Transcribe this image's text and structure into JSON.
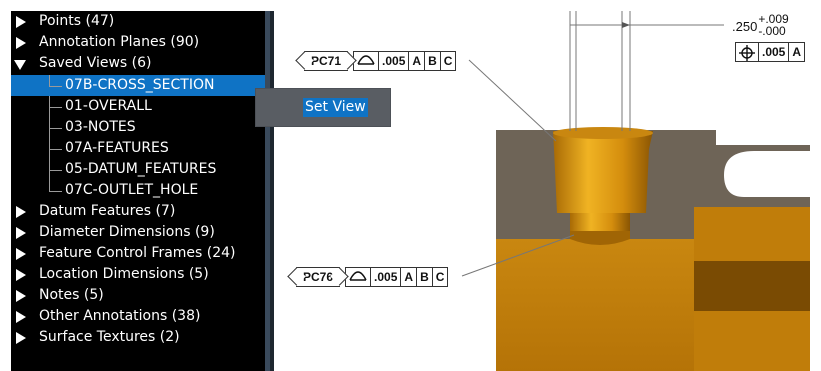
{
  "tree": {
    "top_items": [
      {
        "label": "Points (47)",
        "expanded": false
      },
      {
        "label": "Annotation Planes (90)",
        "expanded": false
      },
      {
        "label": "Saved Views (6)",
        "expanded": true
      },
      {
        "label": "Datum Features (7)",
        "expanded": false
      },
      {
        "label": "Diameter Dimensions (9)",
        "expanded": false
      },
      {
        "label": "Feature Control Frames (24)",
        "expanded": false
      },
      {
        "label": "Location Dimensions (5)",
        "expanded": false
      },
      {
        "label": "Notes (5)",
        "expanded": false
      },
      {
        "label": "Other Annotations (38)",
        "expanded": false
      },
      {
        "label": "Surface Textures (2)",
        "expanded": false
      }
    ],
    "saved_views": [
      {
        "label": "07B-CROSS_SECTION",
        "selected": true
      },
      {
        "label": "01-OVERALL",
        "selected": false
      },
      {
        "label": "03-NOTES",
        "selected": false
      },
      {
        "label": "07A-FEATURES",
        "selected": false
      },
      {
        "label": "05-DATUM_FEATURES",
        "selected": false
      },
      {
        "label": "07C-OUTLET_HOLE",
        "selected": false
      }
    ]
  },
  "context_menu": {
    "set_view": "Set View"
  },
  "annotations": {
    "fcf1": {
      "tag": "PC71",
      "tolerance": ".005",
      "datums": [
        "A",
        "B",
        "C"
      ]
    },
    "fcf2": {
      "tag": "PC76",
      "tolerance": ".005",
      "datums": [
        "A",
        "B",
        "C"
      ]
    },
    "fcf3": {
      "tolerance": ".005",
      "datums": [
        "A"
      ]
    },
    "dimension": {
      "nominal": ".250",
      "upper": "+.009",
      "lower": "-.000"
    }
  },
  "colors": {
    "selection": "#0f73c5",
    "part": "#d9920e",
    "section": "#6e6457"
  }
}
